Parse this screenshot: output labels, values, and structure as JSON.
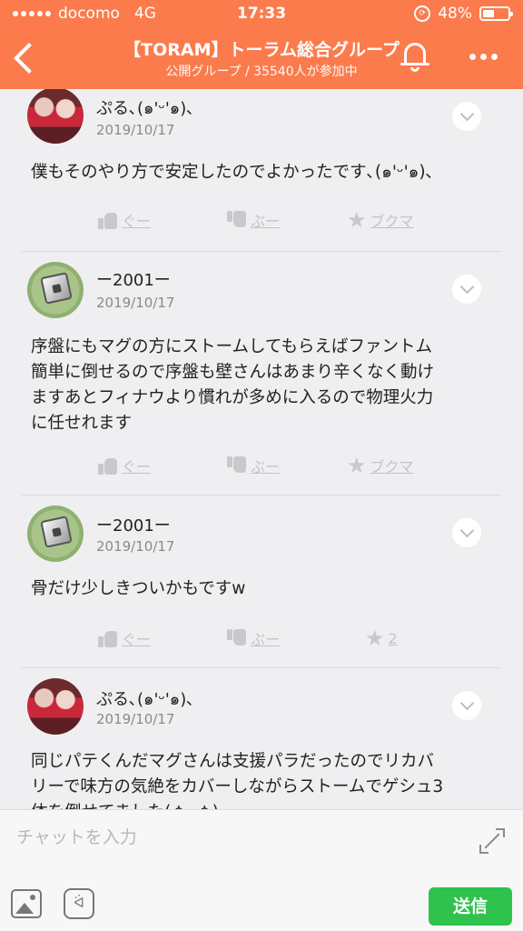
{
  "status_bar": {
    "carrier": "docomo",
    "network": "4G",
    "time": "17:33",
    "battery_percent": 48,
    "battery_text": "48%"
  },
  "header": {
    "title": "【TORAM】トーラム総合グループ",
    "subtitle": "公開グループ / 35540人が参加中"
  },
  "posts": [
    {
      "author": "ぷる､(๑'ᵕ'๑)､",
      "date": "2019/10/17",
      "lines": [
        "僕もそのやり方で安定したのでよかったです､(๑'ᵕ'๑)､"
      ],
      "like": "ぐー",
      "dislike": "ぶー",
      "bookmark": "ブクマ"
    },
    {
      "author": "ー2001ー",
      "date": "2019/10/17",
      "lines": [
        "序盤にもマグの方にストームしてもらえばファントム",
        "簡単に倒せるので序盤も壁さんはあまり辛くなく動け",
        "ますあとフィナウより慣れが多めに入るので物理火力",
        "に任せれます"
      ],
      "like": "ぐー",
      "dislike": "ぶー",
      "bookmark": "ブクマ"
    },
    {
      "author": "ー2001ー",
      "date": "2019/10/17",
      "lines": [
        "骨だけ少しきついかもですw"
      ],
      "like": "ぐー",
      "dislike": "ぶー",
      "bookmark": "2"
    },
    {
      "author": "ぷる､(๑'ᵕ'๑)､",
      "date": "2019/10/17",
      "lines": [
        "同じパテくんだマグさんは支援パラだったのでリカバ",
        "リーで味方の気絶をカバーしながらストームでゲシュ3",
        "体を倒せてました(ㆁᴗㆁ)"
      ]
    }
  ],
  "composer": {
    "placeholder": "チャットを入力",
    "send_label": "送信",
    "sticker_face": "ᐛ"
  }
}
